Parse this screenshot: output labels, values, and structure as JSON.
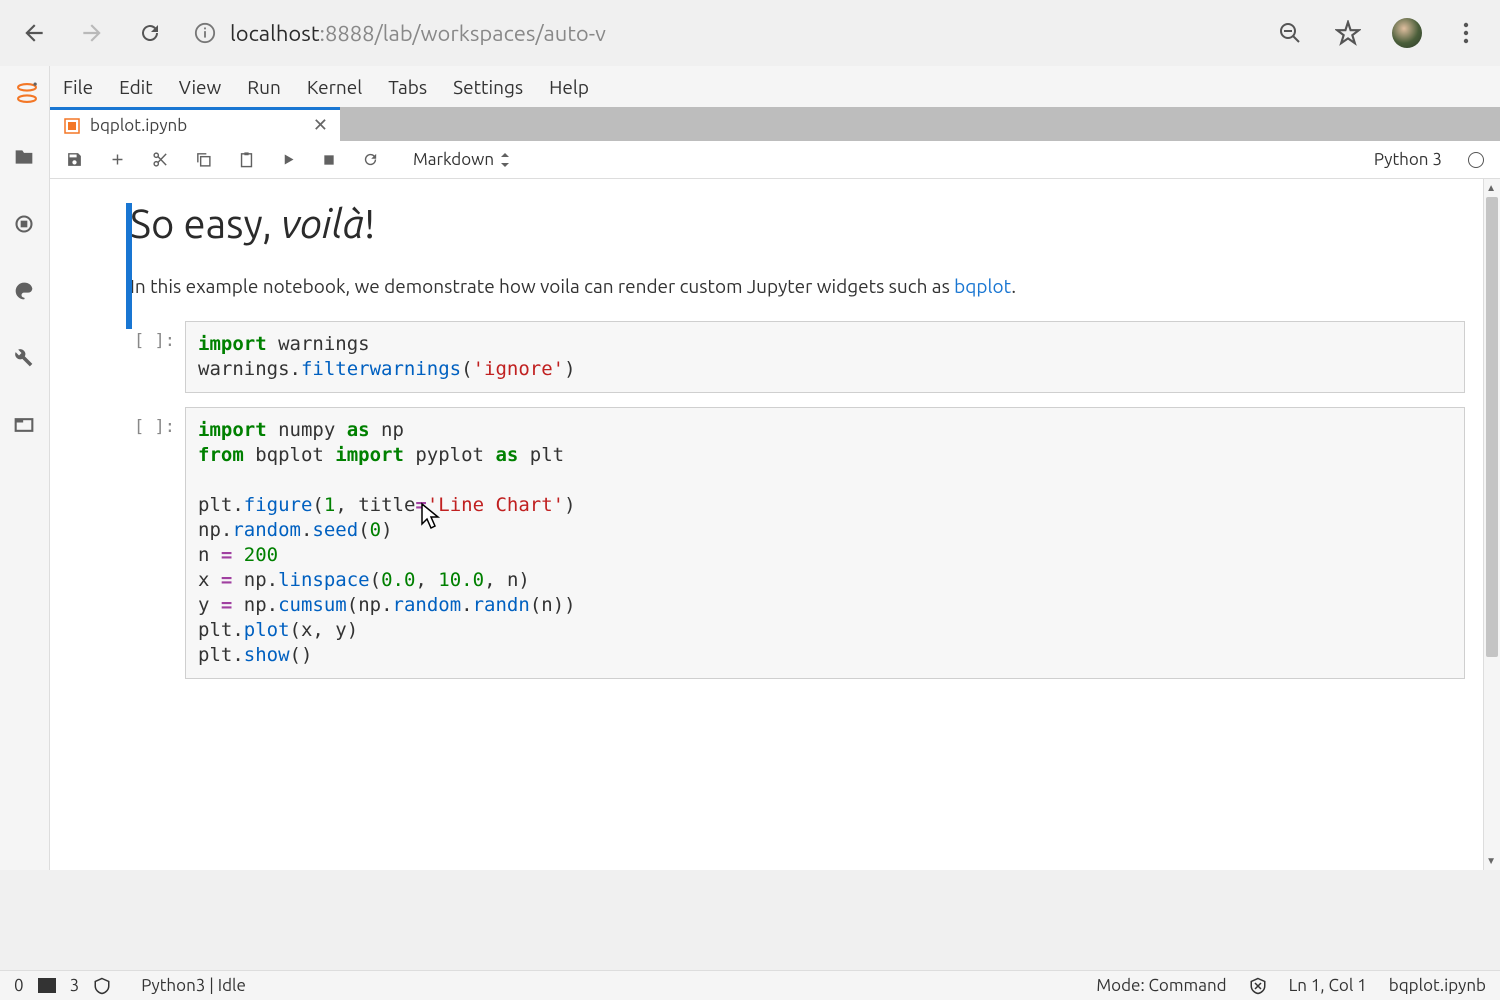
{
  "browser": {
    "url_host": "localhost",
    "url_rest": ":8888/lab/workspaces/auto-v"
  },
  "menu": [
    "File",
    "Edit",
    "View",
    "Run",
    "Kernel",
    "Tabs",
    "Settings",
    "Help"
  ],
  "tab": {
    "title": "bqplot.ipynb"
  },
  "toolbar": {
    "celltype": "Markdown",
    "kernel_name": "Python 3"
  },
  "markdown": {
    "head_pre": "So easy, ",
    "head_em": "voilà",
    "head_post": "!",
    "para_pre": "In this example notebook, we demonstrate how voila can render custom Jupyter widgets such as ",
    "para_link": "bqplot",
    "para_post": "."
  },
  "cells": {
    "prompt": "[ ]:",
    "code1": {
      "l1a": "import",
      "l1b": " warnings",
      "l2a": "warnings.",
      "l2b": "filterwarnings",
      "l2c": "(",
      "l2d": "'ignore'",
      "l2e": ")"
    },
    "code2": {
      "l1a": "import",
      "l1b": " numpy ",
      "l1c": "as",
      "l1d": " np",
      "l2a": "from",
      "l2b": " bqplot ",
      "l2c": "import",
      "l2d": " pyplot ",
      "l2e": "as",
      "l2f": " plt",
      "l4a": "plt.",
      "l4b": "figure",
      "l4c": "(",
      "l4d": "1",
      "l4e": ", title",
      "l4f": "=",
      "l4g": "'Line Chart'",
      "l4h": ")",
      "l5a": "np.",
      "l5b": "random",
      "l5c": ".",
      "l5d": "seed",
      "l5e": "(",
      "l5f": "0",
      "l5g": ")",
      "l6a": "n ",
      "l6b": "=",
      "l6c": " ",
      "l6d": "200",
      "l7a": "x ",
      "l7b": "=",
      "l7c": " np.",
      "l7d": "linspace",
      "l7e": "(",
      "l7f": "0.0",
      "l7g": ", ",
      "l7h": "10.0",
      "l7i": ", n)",
      "l8a": "y ",
      "l8b": "=",
      "l8c": " np.",
      "l8d": "cumsum",
      "l8e": "(np.",
      "l8f": "random",
      "l8g": ".",
      "l8h": "randn",
      "l8i": "(n))",
      "l9a": "plt.",
      "l9b": "plot",
      "l9c": "(x, y)",
      "l10a": "plt.",
      "l10b": "show",
      "l10c": "()"
    }
  },
  "status": {
    "left_num": "0",
    "left_num2": "3",
    "kernel": "Python3 | Idle",
    "mode": "Mode: Command",
    "cursor": "Ln 1, Col 1",
    "file": "bqplot.ipynb"
  }
}
